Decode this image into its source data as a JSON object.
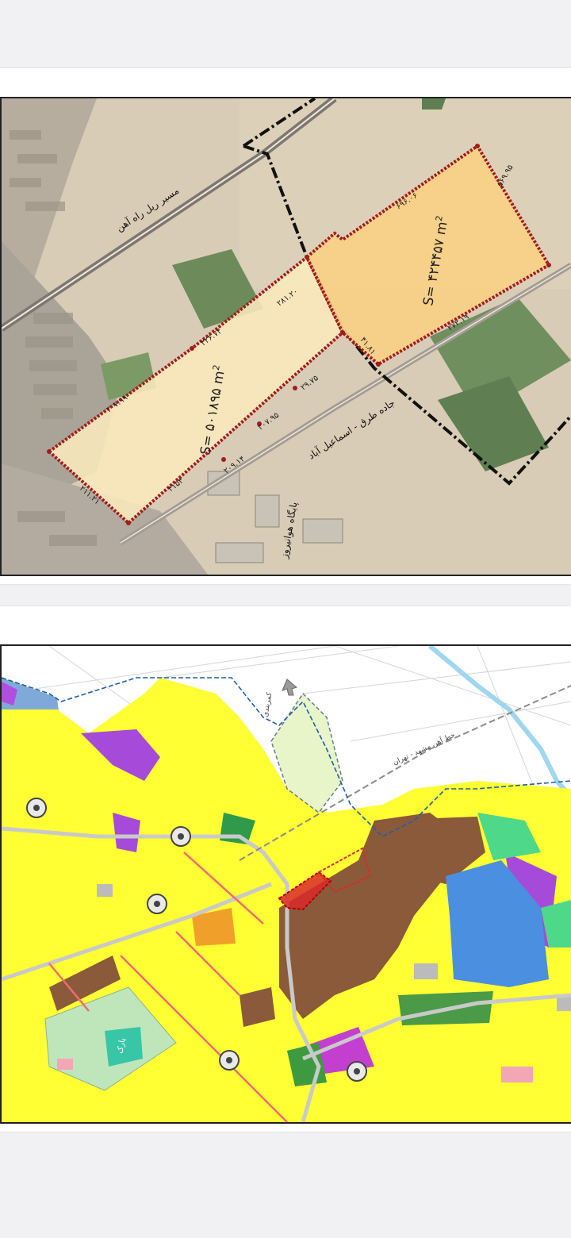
{
  "satellite_map": {
    "parcel_west": {
      "area": "S= ۵۰۱۸۹۵ m",
      "area_sup": "2",
      "edge_labels": [
        "۴۱۵۳",
        "۲۰۹.۱۴",
        "۲۰۷.۹۵",
        "۲۹.۷۵",
        "۲۸۱.۲۰",
        "۳۲۶.۷۴",
        "۲۰۷.۹۹",
        "۲۱۱.۲۱"
      ]
    },
    "parcel_east": {
      "area": "S= ۴۲۴۴۵۷ m",
      "area_sup": "2",
      "edge_labels": [
        "۲۷۲.۱۹",
        "۵۶۹.۹۵",
        "۶۹۶.۰۶",
        "۴۱.۸۱"
      ]
    },
    "labels": {
      "railway": "مسیر ریل راه آهن",
      "road": "جاده طرق - اسماعیل آباد",
      "airbase": "پایگاه هوانیروز"
    }
  },
  "zoning_map": {
    "labels": {
      "railway": "خط آهن مشهد - تهران",
      "park": "پارک",
      "ring_road": "کمربندی"
    }
  },
  "colors": {
    "page_bg": "#f1f1f3",
    "parcel_west_fill": "#fbe9bd",
    "parcel_east_fill": "#f9cf86",
    "boundary_red": "#a11d1d",
    "boundary_black": "#111111",
    "residential_yellow": "#ffff33",
    "industrial_brown": "#8a5a3a",
    "blue_zone": "#4a8fe0",
    "purple_zone": "#a64bd9",
    "green_zone": "#4ed88a",
    "light_green_zone": "#e8f5c8",
    "park_green": "#bfe6bb",
    "highlight_red": "#d92a2a"
  }
}
